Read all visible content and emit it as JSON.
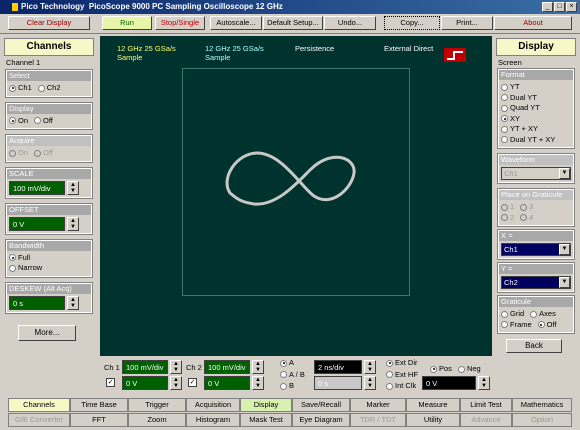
{
  "window": {
    "brand": "Pico Technology",
    "title": "PicoScope 9000   PC Sampling Oscilloscope 12 GHz",
    "min": "_",
    "max": "□",
    "close": "×"
  },
  "toolbar": {
    "clear": "Clear Display",
    "run": "Run",
    "stop": "Stop/Single",
    "autoscale": "Autoscale...",
    "default": "Default Setup...",
    "undo": "Undo...",
    "copy": "Copy...",
    "print": "Print...",
    "about": "About"
  },
  "channels": {
    "title": "Channels",
    "group": "Channel 1",
    "select": {
      "label": "Select",
      "ch1": "Ch1",
      "ch2": "Ch2"
    },
    "display": {
      "label": "Display",
      "on": "On",
      "off": "Off"
    },
    "acquire": {
      "label": "Acquire",
      "on": "On",
      "off": "Off"
    },
    "scale": {
      "label": "SCALE",
      "value": "100 mV/div"
    },
    "offset": {
      "label": "OFFSET",
      "value": "0 V"
    },
    "bandwidth": {
      "label": "Bandwidth",
      "full": "Full",
      "narrow": "Narrow"
    },
    "deskew": {
      "label": "DESKEW (Alt Acq)",
      "value": "0 s"
    },
    "more": "More..."
  },
  "scope": {
    "s1a": "12 GHz  25 GSa/s",
    "s1b": "Sample",
    "s2a": "12 GHz  25 GSa/s",
    "s2b": "Sample",
    "s3": "Persistence",
    "s4": "External Direct"
  },
  "display": {
    "title": "Display",
    "screen": "Screen",
    "format": {
      "label": "Format",
      "opts": [
        "YT",
        "Dual YT",
        "Quad YT",
        "XY",
        "YT + XY",
        "Dual YT + XY"
      ],
      "selected": 3
    },
    "waveform": {
      "label": "Waveform",
      "value": "Ch1"
    },
    "place": {
      "label": "Place on Graticule",
      "opts": [
        "1",
        "3",
        "2",
        "4"
      ]
    },
    "x": {
      "label": "X =",
      "value": "Ch1"
    },
    "y": {
      "label": "Y =",
      "value": "Ch2"
    },
    "graticule": {
      "label": "Graticule",
      "grid": "Grid",
      "axes": "Axes",
      "frame": "Frame",
      "off": "Off"
    },
    "back": "Back"
  },
  "bottom": {
    "ch1": "Ch 1",
    "ch1scale": "100 mV/div",
    "ch1off": "0 V",
    "ch2": "Ch 2",
    "ch2scale": "100 mV/div",
    "ch2off": "0 V",
    "tbA": "A",
    "tbAB": "A / B",
    "tbB": "B",
    "tbscale": "2 ns/div",
    "tbpos": "0 s",
    "extdir": "Ext Dir",
    "exthf": "Ext HF",
    "intclk": "Int Clk",
    "trigval": "0 V",
    "pos": "Pos",
    "neg": "Neg"
  },
  "tabs1": [
    "Channels",
    "Time Base",
    "Trigger",
    "Acquisition",
    "Display",
    "Save/Recall",
    "Marker",
    "Measure",
    "Limit Test",
    "Mathematics"
  ],
  "tabs2": [
    "O/E Converter",
    "FFT",
    "Zoom",
    "Histogram",
    "Mask Test",
    "Eye Diagram",
    "TDR / TDT",
    "Utility",
    "Advance",
    "Option"
  ]
}
